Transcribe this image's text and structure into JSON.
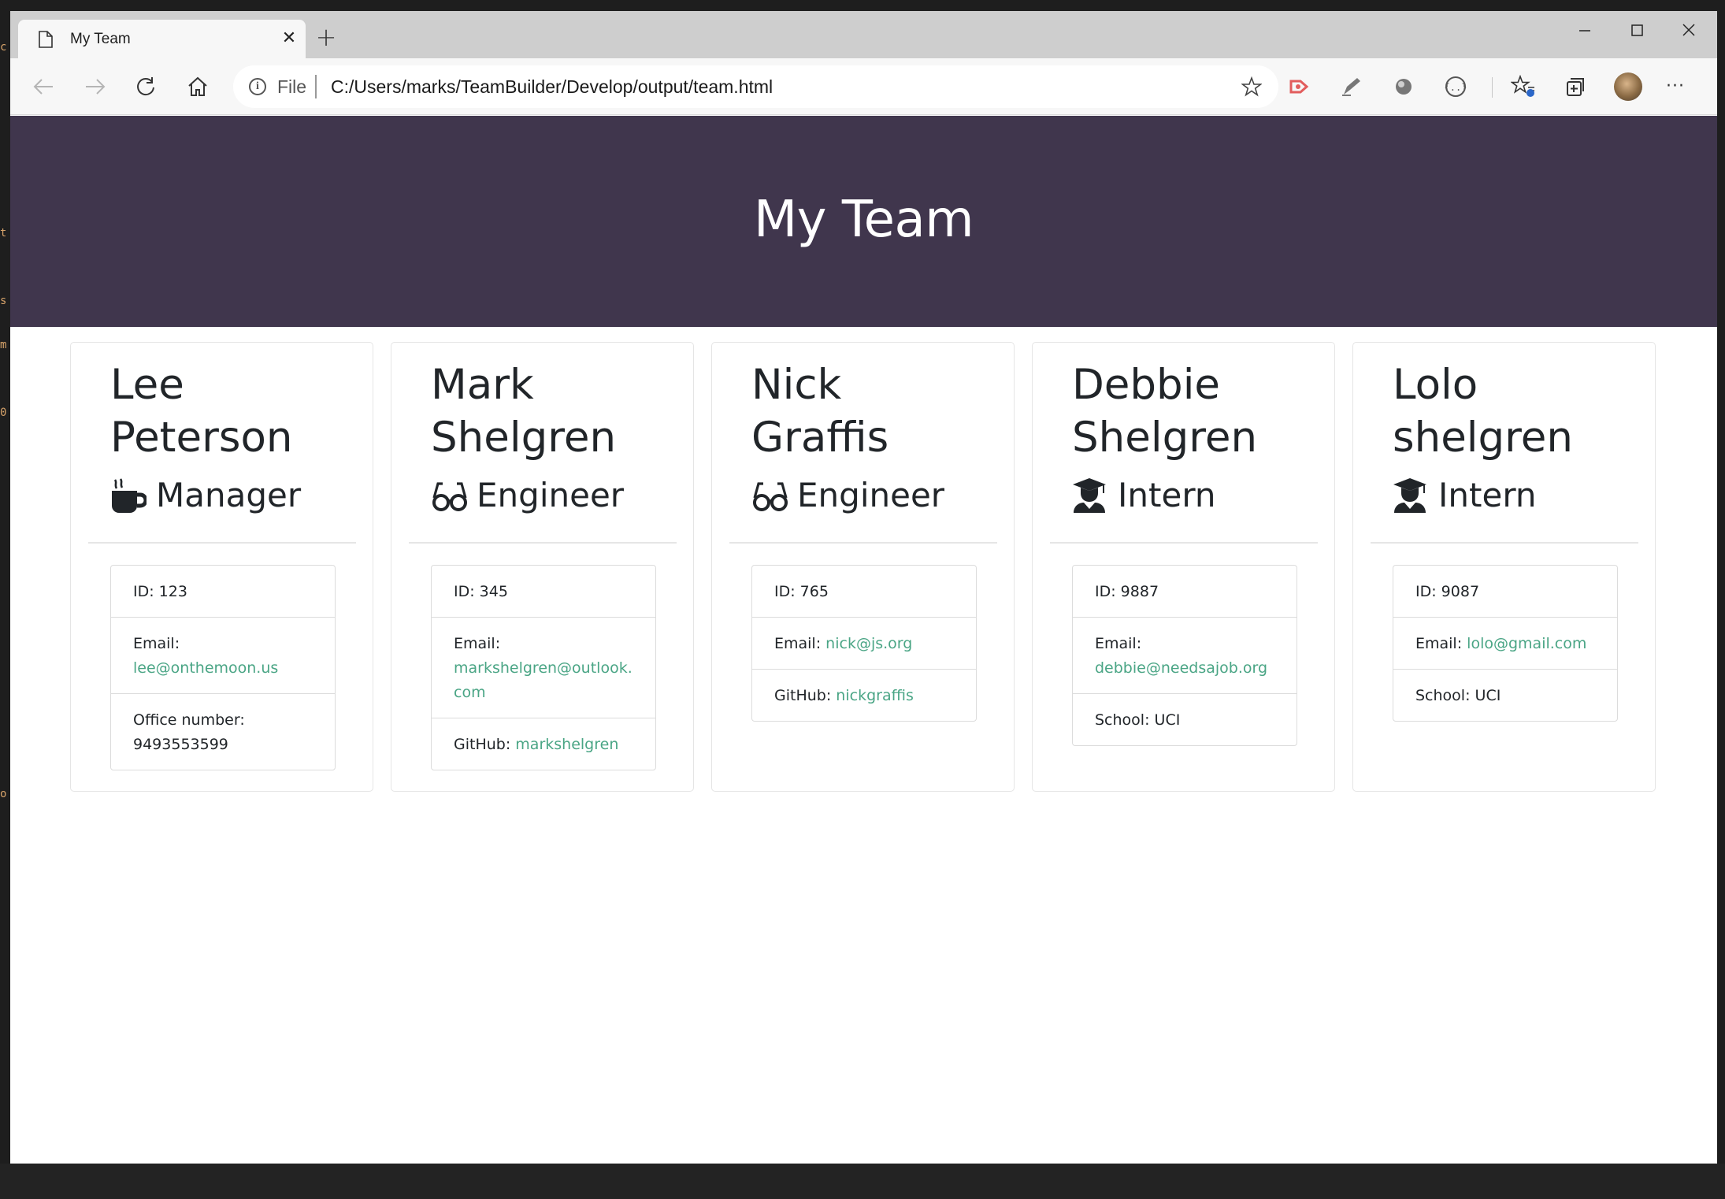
{
  "browser": {
    "tab_title": "My Team",
    "address_prefix": "File",
    "url": "C:/Users/marks/TeamBuilder/Develop/output/team.html"
  },
  "header": {
    "title": "My Team"
  },
  "link_color": "#4aa585",
  "header_color": "#40364d",
  "team": [
    {
      "name_line1": "Lee",
      "name_line2": "Peterson",
      "role": "Manager",
      "role_icon": "coffee-mug-icon",
      "id": "ID: 123",
      "email_label": "Email:",
      "email": "lee@onthemoon.us",
      "extra_label": "Office number:",
      "extra_value": "9493553599"
    },
    {
      "name_line1": "Mark",
      "name_line2": "Shelgren",
      "role": "Engineer",
      "role_icon": "glasses-icon",
      "id": "ID: 345",
      "email_label": "Email:",
      "email": "markshelgren@outlook.com",
      "extra_label": "GitHub:",
      "extra_value": "markshelgren"
    },
    {
      "name_line1": "Nick",
      "name_line2": "Graffis",
      "role": "Engineer",
      "role_icon": "glasses-icon",
      "id": "ID: 765",
      "email_label": "Email:",
      "email": "nick@js.org",
      "extra_label": "GitHub:",
      "extra_value": "nickgraffis"
    },
    {
      "name_line1": "Debbie",
      "name_line2": "Shelgren",
      "role": "Intern",
      "role_icon": "graduate-icon",
      "id": "ID: 9887",
      "email_label": "Email:",
      "email": "debbie@needsajob.org",
      "extra_label": "School:",
      "extra_value": "UCI"
    },
    {
      "name_line1": "Lolo",
      "name_line2": "shelgren",
      "role": "Intern",
      "role_icon": "graduate-icon",
      "id": "ID: 9087",
      "email_label": "Email:",
      "email": "lolo@gmail.com",
      "extra_label": "School:",
      "extra_value": "UCI"
    }
  ]
}
